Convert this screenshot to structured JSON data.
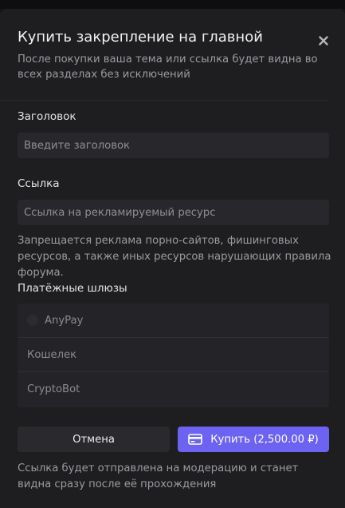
{
  "modal": {
    "title": "Купить закрепление на главной",
    "subtitle": "После покупки ваша тема или ссылка будет видна во всех разделах без исключений"
  },
  "form": {
    "title_label": "Заголовок",
    "title_placeholder": "Введите заголовок",
    "title_value": "",
    "link_label": "Ссылка",
    "link_placeholder": "Ссылка на рекламируемый ресурс",
    "link_value": "",
    "link_hint": "Запрещается реклама порно-сайтов, фишинговых ресурсов, а также иных ресурсов нарушающих правила форума."
  },
  "gateways": {
    "label": "Платёжные шлюзы",
    "items": [
      {
        "name": "AnyPay"
      },
      {
        "name": "Кошелек"
      },
      {
        "name": "CryptoBot"
      }
    ]
  },
  "actions": {
    "cancel_label": "Отмена",
    "buy_label": "Купить (2,500.00 ₽)"
  },
  "footer_note": "Ссылка будет отправлена на модерацию и станет видна сразу после её прохождения",
  "colors": {
    "accent": "#6c63f0",
    "modal_bg": "#1e1e21",
    "input_bg": "#28282c"
  }
}
